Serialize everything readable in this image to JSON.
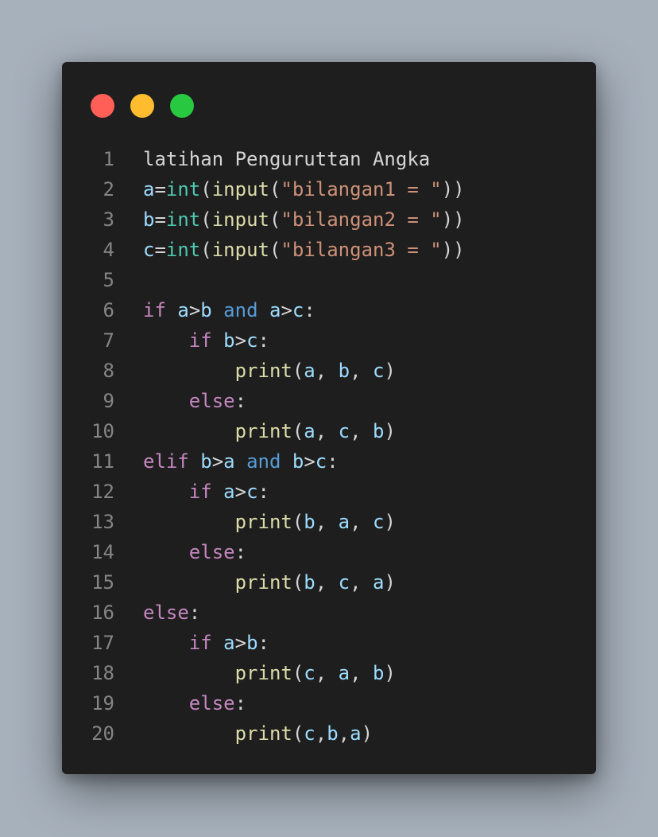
{
  "window": {
    "buttons": [
      {
        "name": "close-dot",
        "color": "#ff5f57"
      },
      {
        "name": "minimize-dot",
        "color": "#febc2e"
      },
      {
        "name": "maximize-dot",
        "color": "#28c840"
      }
    ]
  },
  "colors": {
    "plain": "#d4d4d4",
    "keyword": "#c586c0",
    "operator_keyword": "#569cd6",
    "variable": "#9cdcfe",
    "builtin": "#4ec9b0",
    "function": "#dcdcaa",
    "string": "#ce9178",
    "line_number": "#858585"
  },
  "code": {
    "lines": [
      {
        "num": "1",
        "tokens": [
          [
            "plain",
            "latihan Penguruttan Angka"
          ]
        ]
      },
      {
        "num": "2",
        "tokens": [
          [
            "variable",
            "a"
          ],
          [
            "plain",
            "="
          ],
          [
            "builtin",
            "int"
          ],
          [
            "plain",
            "("
          ],
          [
            "function",
            "input"
          ],
          [
            "plain",
            "("
          ],
          [
            "string",
            "\"bilangan1 = \""
          ],
          [
            "plain",
            "))"
          ]
        ]
      },
      {
        "num": "3",
        "tokens": [
          [
            "variable",
            "b"
          ],
          [
            "plain",
            "="
          ],
          [
            "builtin",
            "int"
          ],
          [
            "plain",
            "("
          ],
          [
            "function",
            "input"
          ],
          [
            "plain",
            "("
          ],
          [
            "string",
            "\"bilangan2 = \""
          ],
          [
            "plain",
            "))"
          ]
        ]
      },
      {
        "num": "4",
        "tokens": [
          [
            "variable",
            "c"
          ],
          [
            "plain",
            "="
          ],
          [
            "builtin",
            "int"
          ],
          [
            "plain",
            "("
          ],
          [
            "function",
            "input"
          ],
          [
            "plain",
            "("
          ],
          [
            "string",
            "\"bilangan3 = \""
          ],
          [
            "plain",
            "))"
          ]
        ]
      },
      {
        "num": "5",
        "tokens": []
      },
      {
        "num": "6",
        "tokens": [
          [
            "keyword",
            "if"
          ],
          [
            "plain",
            " "
          ],
          [
            "variable",
            "a"
          ],
          [
            "plain",
            ">"
          ],
          [
            "variable",
            "b"
          ],
          [
            "plain",
            " "
          ],
          [
            "operator_keyword",
            "and"
          ],
          [
            "plain",
            " "
          ],
          [
            "variable",
            "a"
          ],
          [
            "plain",
            ">"
          ],
          [
            "variable",
            "c"
          ],
          [
            "plain",
            ":"
          ]
        ]
      },
      {
        "num": "7",
        "tokens": [
          [
            "plain",
            "    "
          ],
          [
            "keyword",
            "if"
          ],
          [
            "plain",
            " "
          ],
          [
            "variable",
            "b"
          ],
          [
            "plain",
            ">"
          ],
          [
            "variable",
            "c"
          ],
          [
            "plain",
            ":"
          ]
        ]
      },
      {
        "num": "8",
        "tokens": [
          [
            "plain",
            "        "
          ],
          [
            "function",
            "print"
          ],
          [
            "plain",
            "("
          ],
          [
            "variable",
            "a"
          ],
          [
            "plain",
            ", "
          ],
          [
            "variable",
            "b"
          ],
          [
            "plain",
            ", "
          ],
          [
            "variable",
            "c"
          ],
          [
            "plain",
            ")"
          ]
        ]
      },
      {
        "num": "9",
        "tokens": [
          [
            "plain",
            "    "
          ],
          [
            "keyword",
            "else"
          ],
          [
            "plain",
            ":"
          ]
        ]
      },
      {
        "num": "10",
        "tokens": [
          [
            "plain",
            "        "
          ],
          [
            "function",
            "print"
          ],
          [
            "plain",
            "("
          ],
          [
            "variable",
            "a"
          ],
          [
            "plain",
            ", "
          ],
          [
            "variable",
            "c"
          ],
          [
            "plain",
            ", "
          ],
          [
            "variable",
            "b"
          ],
          [
            "plain",
            ")"
          ]
        ]
      },
      {
        "num": "11",
        "tokens": [
          [
            "keyword",
            "elif"
          ],
          [
            "plain",
            " "
          ],
          [
            "variable",
            "b"
          ],
          [
            "plain",
            ">"
          ],
          [
            "variable",
            "a"
          ],
          [
            "plain",
            " "
          ],
          [
            "operator_keyword",
            "and"
          ],
          [
            "plain",
            " "
          ],
          [
            "variable",
            "b"
          ],
          [
            "plain",
            ">"
          ],
          [
            "variable",
            "c"
          ],
          [
            "plain",
            ":"
          ]
        ]
      },
      {
        "num": "12",
        "tokens": [
          [
            "plain",
            "    "
          ],
          [
            "keyword",
            "if"
          ],
          [
            "plain",
            " "
          ],
          [
            "variable",
            "a"
          ],
          [
            "plain",
            ">"
          ],
          [
            "variable",
            "c"
          ],
          [
            "plain",
            ":"
          ]
        ]
      },
      {
        "num": "13",
        "tokens": [
          [
            "plain",
            "        "
          ],
          [
            "function",
            "print"
          ],
          [
            "plain",
            "("
          ],
          [
            "variable",
            "b"
          ],
          [
            "plain",
            ", "
          ],
          [
            "variable",
            "a"
          ],
          [
            "plain",
            ", "
          ],
          [
            "variable",
            "c"
          ],
          [
            "plain",
            ")"
          ]
        ]
      },
      {
        "num": "14",
        "tokens": [
          [
            "plain",
            "    "
          ],
          [
            "keyword",
            "else"
          ],
          [
            "plain",
            ":"
          ]
        ]
      },
      {
        "num": "15",
        "tokens": [
          [
            "plain",
            "        "
          ],
          [
            "function",
            "print"
          ],
          [
            "plain",
            "("
          ],
          [
            "variable",
            "b"
          ],
          [
            "plain",
            ", "
          ],
          [
            "variable",
            "c"
          ],
          [
            "plain",
            ", "
          ],
          [
            "variable",
            "a"
          ],
          [
            "plain",
            ")"
          ]
        ]
      },
      {
        "num": "16",
        "tokens": [
          [
            "keyword",
            "else"
          ],
          [
            "plain",
            ":"
          ]
        ]
      },
      {
        "num": "17",
        "tokens": [
          [
            "plain",
            "    "
          ],
          [
            "keyword",
            "if"
          ],
          [
            "plain",
            " "
          ],
          [
            "variable",
            "a"
          ],
          [
            "plain",
            ">"
          ],
          [
            "variable",
            "b"
          ],
          [
            "plain",
            ":"
          ]
        ]
      },
      {
        "num": "18",
        "tokens": [
          [
            "plain",
            "        "
          ],
          [
            "function",
            "print"
          ],
          [
            "plain",
            "("
          ],
          [
            "variable",
            "c"
          ],
          [
            "plain",
            ", "
          ],
          [
            "variable",
            "a"
          ],
          [
            "plain",
            ", "
          ],
          [
            "variable",
            "b"
          ],
          [
            "plain",
            ")"
          ]
        ]
      },
      {
        "num": "19",
        "tokens": [
          [
            "plain",
            "    "
          ],
          [
            "keyword",
            "else"
          ],
          [
            "plain",
            ":"
          ]
        ]
      },
      {
        "num": "20",
        "tokens": [
          [
            "plain",
            "        "
          ],
          [
            "function",
            "print"
          ],
          [
            "plain",
            "("
          ],
          [
            "variable",
            "c"
          ],
          [
            "plain",
            ","
          ],
          [
            "variable",
            "b"
          ],
          [
            "plain",
            ","
          ],
          [
            "variable",
            "a"
          ],
          [
            "plain",
            ")"
          ]
        ]
      }
    ]
  }
}
